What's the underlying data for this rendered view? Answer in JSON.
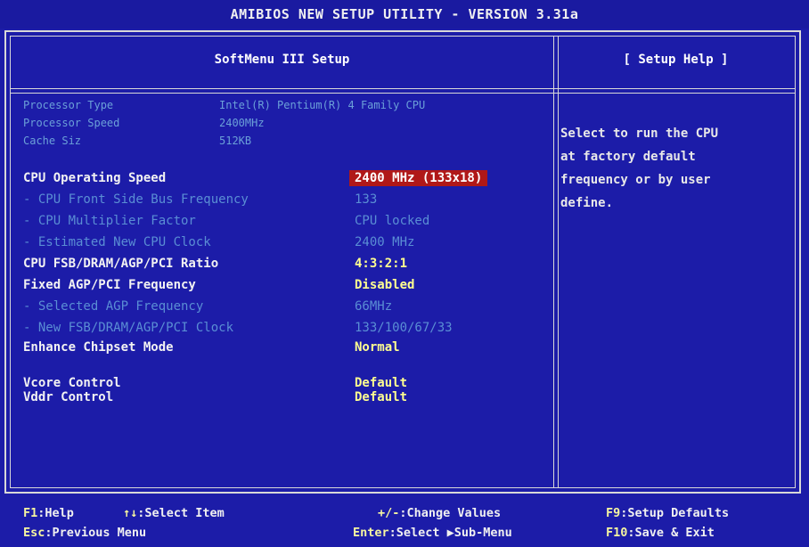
{
  "title": "AMIBIOS NEW SETUP UTILITY - VERSION 3.31a",
  "left_header": "SoftMenu III Setup",
  "right_header": "[ Setup Help ]",
  "info": [
    {
      "label": "Processor Type",
      "value": "Intel(R) Pentium(R) 4 Family CPU"
    },
    {
      "label": "Processor Speed",
      "value": "2400MHz"
    },
    {
      "label": "Cache Siz",
      "value": "512KB"
    }
  ],
  "settings": [
    {
      "label": "CPU Operating Speed",
      "value": "2400 MHz (133x18)",
      "kind": "main",
      "selected": true
    },
    {
      "label": "- CPU Front Side Bus Frequency",
      "value": "133",
      "kind": "sub"
    },
    {
      "label": "- CPU Multiplier Factor",
      "value": "CPU locked",
      "kind": "sub"
    },
    {
      "label": "- Estimated New CPU Clock",
      "value": "2400 MHz",
      "kind": "sub"
    },
    {
      "label": "CPU FSB/DRAM/AGP/PCI Ratio",
      "value": "4:3:2:1",
      "kind": "main"
    },
    {
      "label": "Fixed AGP/PCI Frequency",
      "value": "Disabled",
      "kind": "main"
    },
    {
      "label": "- Selected AGP Frequency",
      "value": "66MHz",
      "kind": "sub"
    },
    {
      "label": "- New FSB/DRAM/AGP/PCI Clock",
      "value": "133/100/67/33",
      "kind": "sub"
    },
    {
      "label": "Enhance Chipset Mode",
      "value": "Normal",
      "kind": "main"
    },
    {
      "label": "Vcore Control",
      "value": "Default",
      "kind": "main"
    },
    {
      "label": "Vddr Control",
      "value": "Default",
      "kind": "main"
    }
  ],
  "help_text": "Select to run the CPU\nat factory default\nfrequency or by user\ndefine.",
  "footer": [
    {
      "key": "F1",
      "desc": ":Help"
    },
    {
      "key": "↑↓",
      "desc": ":Select Item"
    },
    {
      "key": "+/-",
      "desc": ":Change Values"
    },
    {
      "key": "F9",
      "desc": ":Setup Defaults"
    },
    {
      "key": "Esc",
      "desc": ":Previous Menu"
    },
    {
      "key": "Enter",
      "desc": ":Select ▶Sub-Menu"
    },
    {
      "key": "F10",
      "desc": ":Save & Exit"
    }
  ],
  "colors": {
    "background": "#1c1ca8",
    "highlight": "#b01818",
    "disabled_text": "#5a8ed4"
  }
}
